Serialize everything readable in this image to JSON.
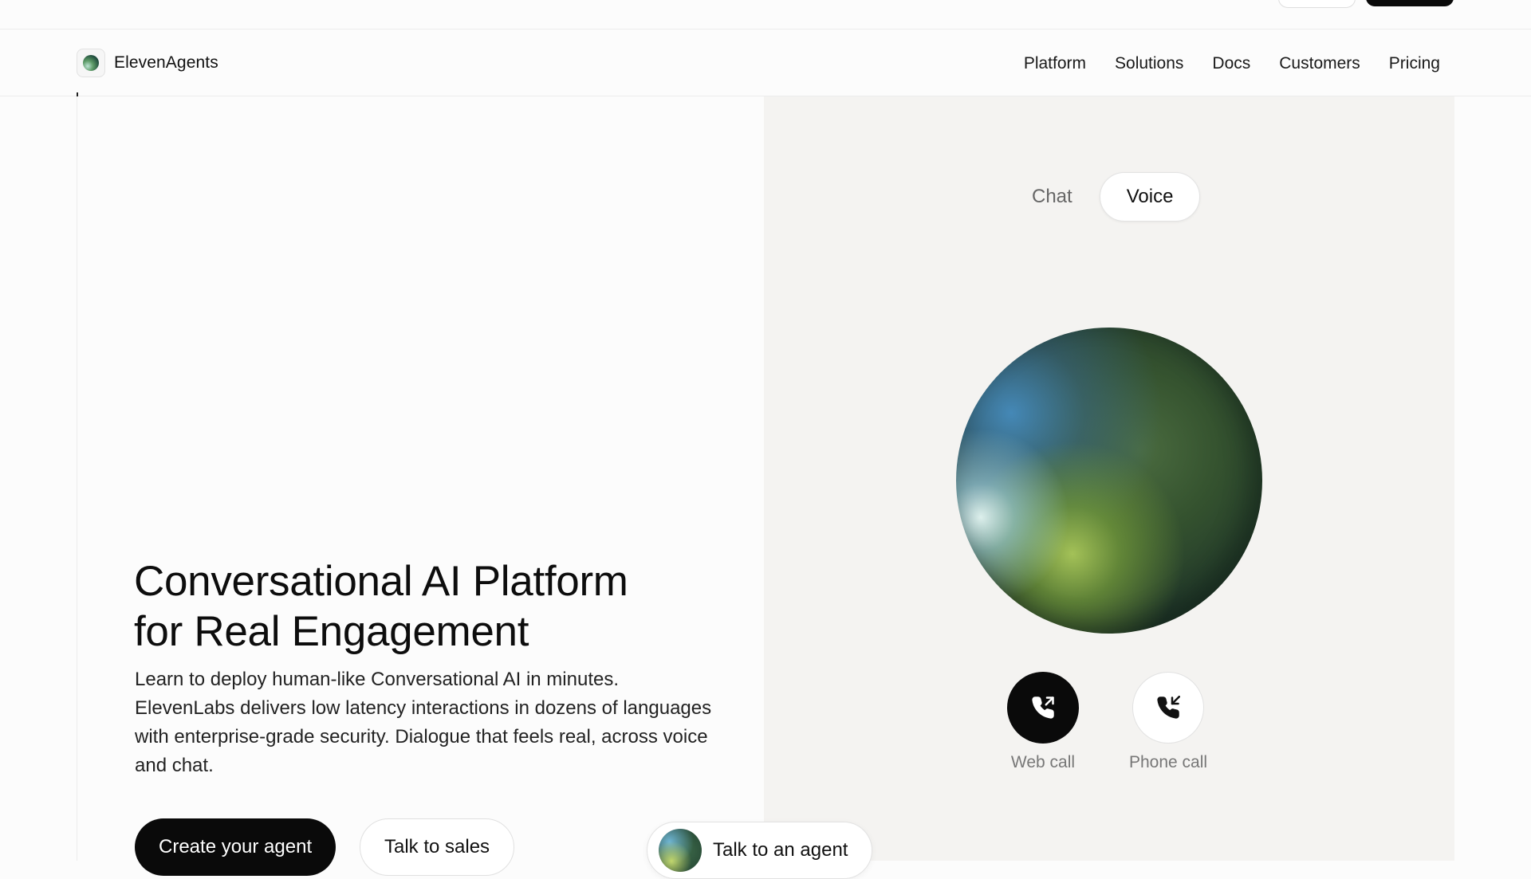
{
  "nav": {
    "brand": "ElevenAgents",
    "links": [
      "Platform",
      "Solutions",
      "Docs",
      "Customers",
      "Pricing"
    ]
  },
  "hero": {
    "title_line1": "Conversational AI Platform",
    "title_line2": "for Real Engagement",
    "description": "Learn to deploy human-like Conversational AI in minutes. ElevenLabs delivers low latency interactions in dozens of languages with enterprise-grade security. Dialogue that feels real, across voice and chat.",
    "primary_cta": "Create your agent",
    "secondary_cta": "Talk to sales"
  },
  "demo": {
    "tabs": [
      "Chat",
      "Voice"
    ],
    "active_tab": "Voice",
    "web_call_label": "Web call",
    "phone_call_label": "Phone call",
    "agent_pill_label": "Talk to an agent"
  },
  "colors": {
    "accent_dark": "#0a0a0a",
    "panel_bg": "#f4f3f1",
    "page_bg": "#fcfcfc"
  }
}
